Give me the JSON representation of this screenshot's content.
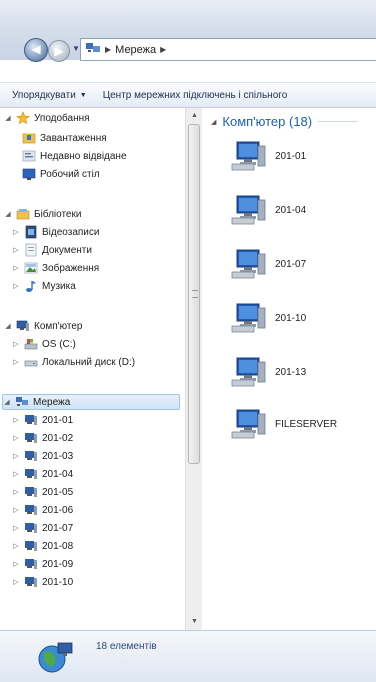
{
  "address": {
    "crumb": "Мережа"
  },
  "toolbar": {
    "organize_label": "Упорядкувати",
    "network_center_label": "Центр мережних підключень і спільного"
  },
  "nav": {
    "favorites": {
      "label": "Уподобання",
      "items": [
        "Завантаження",
        "Недавно відвідане",
        "Робочий стіл"
      ]
    },
    "libraries": {
      "label": "Бібліотеки",
      "items": [
        "Відеозаписи",
        "Документи",
        "Зображення",
        "Музика"
      ]
    },
    "computer": {
      "label": "Комп'ютер",
      "items": [
        "OS (C:)",
        "Локальний диск (D:)"
      ]
    },
    "network": {
      "label": "Мережа",
      "items": [
        "201-01",
        "201-02",
        "201-03",
        "201-04",
        "201-05",
        "201-06",
        "201-07",
        "201-08",
        "201-09",
        "201-10"
      ]
    }
  },
  "content": {
    "group_title": "Комп'ютер (18)",
    "computers": [
      "201-01",
      "201-04",
      "201-07",
      "201-10",
      "201-13",
      "FILESERVER"
    ]
  },
  "status": {
    "count_text": "18 елементів"
  }
}
